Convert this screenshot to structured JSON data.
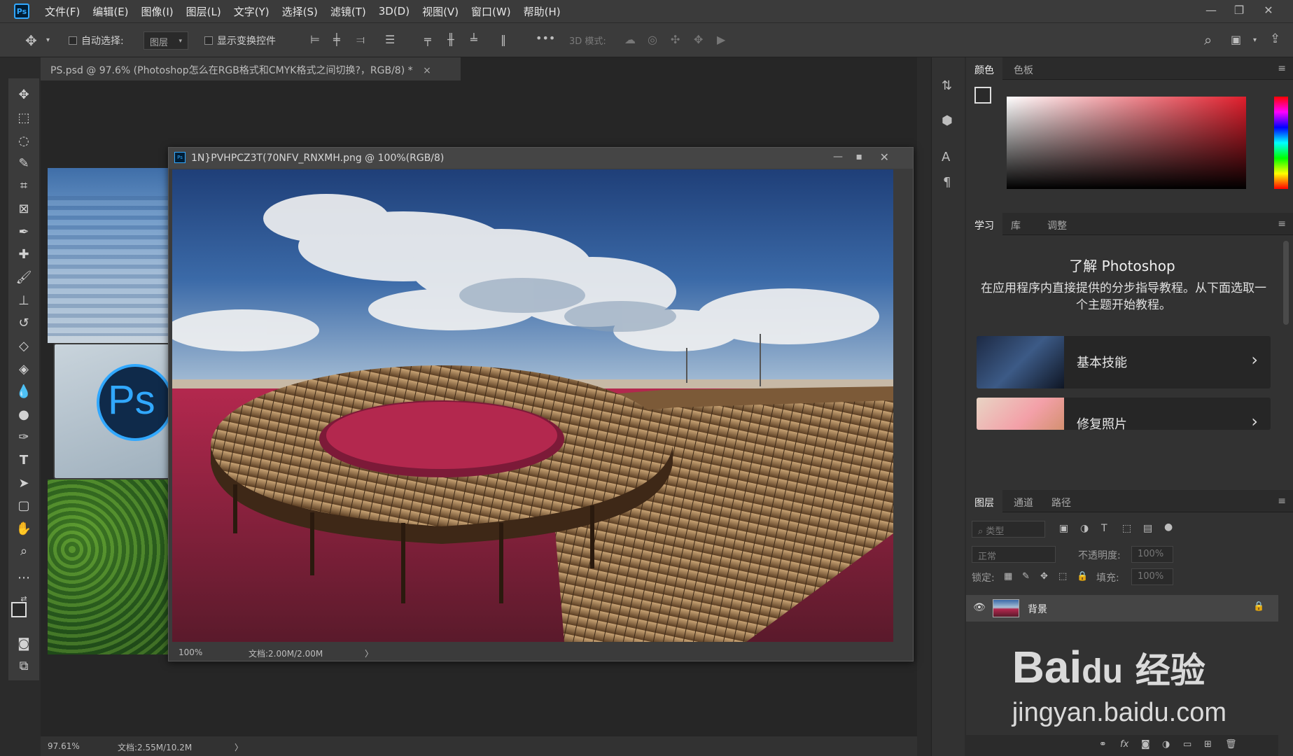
{
  "app": {
    "logo": "Ps",
    "menus": [
      "文件(F)",
      "编辑(E)",
      "图像(I)",
      "图层(L)",
      "文字(Y)",
      "选择(S)",
      "滤镜(T)",
      "3D(D)",
      "视图(V)",
      "窗口(W)",
      "帮助(H)"
    ]
  },
  "options": {
    "auto_select_label": "自动选择:",
    "layer_dropdown": "图层",
    "show_transform_label": "显示变换控件",
    "mode_3d_label": "3D 模式:",
    "more": "•••"
  },
  "document": {
    "tab_title": "PS.psd @ 97.6% (Photoshop怎么在RGB格式和CMYK格式之间切换?，RGB/8) *",
    "tab_close": "×",
    "zoom": "97.61%",
    "doc_info": "文档:2.55M/10.2M",
    "status_arrow": "〉"
  },
  "float_window": {
    "title": "1N}PVHPCZ3T(70NFV_RNXMH.png @ 100%(RGB/8)",
    "zoom": "100%",
    "doc_info": "文档:2.00M/2.00M",
    "status_arrow": "〉"
  },
  "color_panel": {
    "tabs": [
      "颜色",
      "色板"
    ]
  },
  "learn_panel": {
    "tabs": [
      "学习",
      "库",
      "调整"
    ],
    "heading": "了解 Photoshop",
    "description": "在应用程序内直接提供的分步指导教程。从下面选取一个主题开始教程。",
    "cards": [
      "基本技能",
      "修复照片"
    ]
  },
  "layers_panel": {
    "tabs": [
      "图层",
      "通道",
      "路径"
    ],
    "filter_kind": "类型",
    "blend_mode": "正常",
    "opacity_label": "不透明度:",
    "opacity_value": "100%",
    "lock_label": "锁定:",
    "fill_label": "填充:",
    "fill_value": "100%",
    "layers": [
      {
        "name": "背景",
        "visible": true,
        "locked": true
      }
    ]
  },
  "watermark": {
    "brand": "Bai",
    "brand_suffix": "du",
    "suffix_text": "经验",
    "url": "jingyan.baidu.com"
  },
  "colors": {
    "accent": "#31a8ff",
    "panel": "#323232",
    "chrome": "#3b3b3b"
  }
}
